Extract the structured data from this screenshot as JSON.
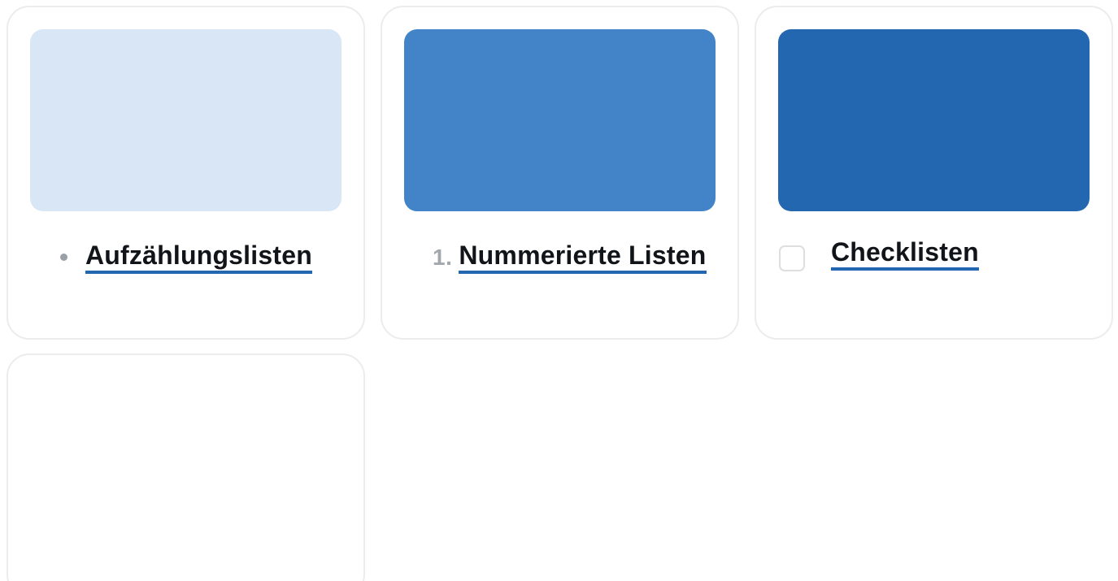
{
  "cards": [
    {
      "swatch_color": "#d9e6f5",
      "marker": "•",
      "label": "Aufzählungslisten"
    },
    {
      "swatch_color": "#4384c8",
      "marker": "1.",
      "label": "Nummerierte Listen"
    },
    {
      "swatch_color": "#2267b0",
      "marker": "checkbox",
      "label": "Checklisten"
    }
  ],
  "colors": {
    "accent_underline": "#2267b0",
    "card_border": "#ececec",
    "marker_gray": "#a3a8ae"
  },
  "icons": {
    "bullet": "bullet-dot-icon",
    "checkbox": "checkbox-unchecked-icon"
  }
}
